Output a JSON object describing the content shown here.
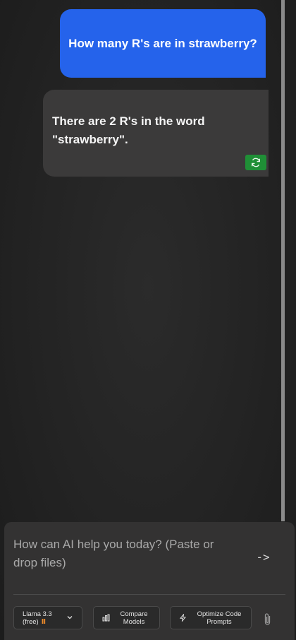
{
  "messages": [
    {
      "role": "user",
      "text": "How many R's are in strawberry?"
    },
    {
      "role": "assistant",
      "line1": "There are 2 R's in the word",
      "line2": "\"strawberry\"."
    }
  ],
  "composer": {
    "placeholder_line1": "How can AI help you today? (Paste or",
    "placeholder_line2": "drop files)",
    "send_label": "->",
    "model": {
      "name": "Llama 3.3",
      "tier": "(free)",
      "badge": "Ⅱ"
    },
    "compare_label_1": "Compare",
    "compare_label_2": "Models",
    "optimize_label_1": "Optimize Code",
    "optimize_label_2": "Prompts"
  },
  "colors": {
    "user_bubble": "#2563eb",
    "assistant_bubble": "#3b3a3a",
    "regenerate_button": "#1f8f36",
    "badge": "#f08c2a"
  },
  "icons": {
    "regenerate": "refresh-icon",
    "model_dropdown": "chevron-down-icon",
    "compare": "bar-chart-icon",
    "optimize": "sparkle-icon",
    "attach": "paperclip-icon"
  }
}
